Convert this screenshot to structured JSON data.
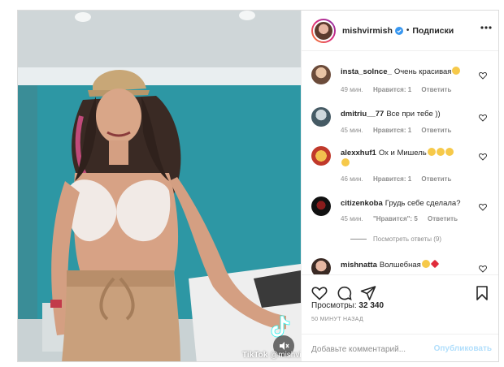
{
  "post": {
    "username": "mishvirmish",
    "separator": "•",
    "follow_label": "Подписки",
    "views_label": "Просмотры:",
    "views_count": "32 340",
    "time_ago": "50 МИНУТ НАЗАД",
    "comment_placeholder": "Добавьте комментарий...",
    "publish_label": "Опубликовать"
  },
  "video": {
    "watermark_prefix": "TikTok",
    "watermark_handle": "@mishvirmish",
    "muted": true
  },
  "comments": [
    {
      "user": "insta_solnce_",
      "text": "Очень красивая",
      "emoji_count": 1,
      "time": "49 мин.",
      "likes": "Нравится: 1",
      "reply": "Ответить"
    },
    {
      "user": "dmitriu__77",
      "text": "Все при тебе ))",
      "emoji_count": 0,
      "time": "45 мин.",
      "likes": "Нравится: 1",
      "reply": "Ответить"
    },
    {
      "user": "alexxhuf1",
      "text": "Ох и Мишель",
      "emoji_count": 4,
      "time": "46 мин.",
      "likes": "Нравится: 1",
      "reply": "Ответить"
    },
    {
      "user": "citizenkoba",
      "text": "Грудь себе сделала?",
      "emoji_count": 0,
      "time": "45 мин.",
      "likes": "\"Нравится\": 5",
      "reply": "Ответить",
      "view_replies": "Посмотреть ответы (9)"
    },
    {
      "user": "mishnatta",
      "text": "Волшебная",
      "emoji_count": 2,
      "time": "",
      "likes": "",
      "reply": ""
    }
  ],
  "colors": {
    "accent": "#0095f6",
    "publish_disabled": "#b2dffc",
    "muted_text": "#8e8e8e",
    "verified": "#3897f0"
  },
  "icons": [
    "more-icon",
    "heart-icon",
    "comment-icon",
    "share-icon",
    "bookmark-icon",
    "verified-badge-icon",
    "mute-icon",
    "tiktok-logo-icon"
  ]
}
